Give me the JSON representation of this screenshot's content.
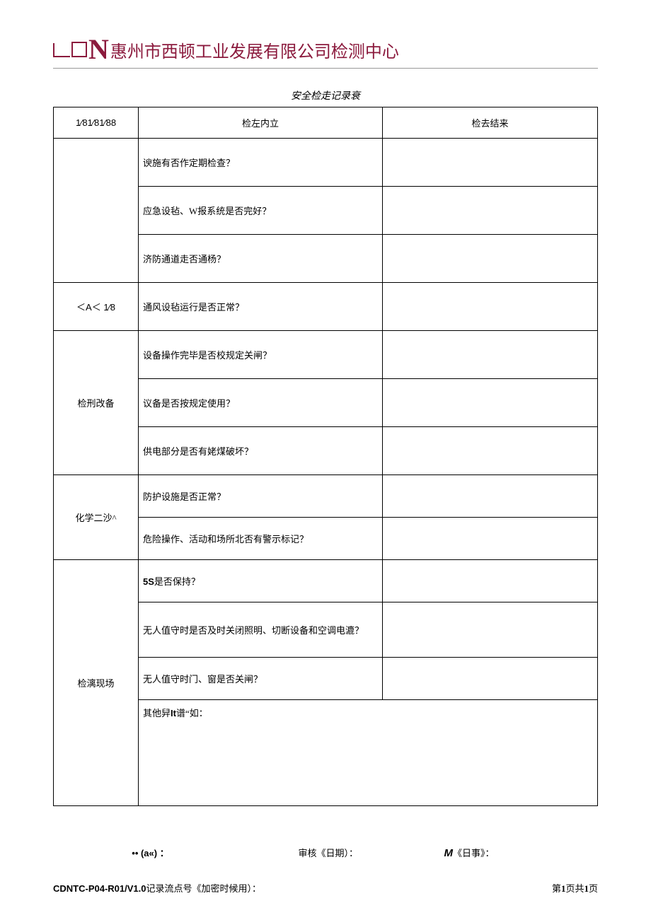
{
  "header": {
    "company_name": "惠州市西顿工业发展有限公司检测中心"
  },
  "doc_title": "安全检走记录衰",
  "table": {
    "headers": {
      "category": "1⁄81⁄81⁄88",
      "content": "检左内立",
      "result": "检去结来"
    },
    "groups": [
      {
        "category": "",
        "items": [
          "谀施有否作定期检查？",
          "应急设毡、W报系统是否完好？",
          "济防通道走否通杨？"
        ]
      },
      {
        "category": "＜A＜ 1⁄8",
        "items": [
          "通风设毡运行是否正常？"
        ]
      },
      {
        "category": "检刑改备",
        "items": [
          "设备操作完毕是否校规定关闸？",
          "议备是否按规定使用？",
          "供电部分是否有姥煤破坏？"
        ]
      },
      {
        "category": "化学二沙^",
        "items": [
          "防护设施是否正常？",
          "危险操作、活动和场所北否有警示标记？"
        ]
      },
      {
        "category": "检漓现场",
        "items": [
          "5S是否保持？",
          "无人值守时是否及时关闭照明、切断设备和空调电漉？",
          "无人值守时门、窗是否关闸？",
          "其他舁It谱“如："
        ]
      }
    ]
  },
  "signatures": {
    "s1": "•• (a«) ：",
    "s2": "审核《日期）：",
    "s3_prefix": "M",
    "s3_rest": "《日事》："
  },
  "footer": {
    "code": "CDNTC-P04-R01/V1.0",
    "code_rest": "记录流点号《加密时候用）：",
    "page_prefix": "第",
    "page_num1": "1",
    "page_mid": "页共",
    "page_num2": "1",
    "page_suffix": "页"
  }
}
